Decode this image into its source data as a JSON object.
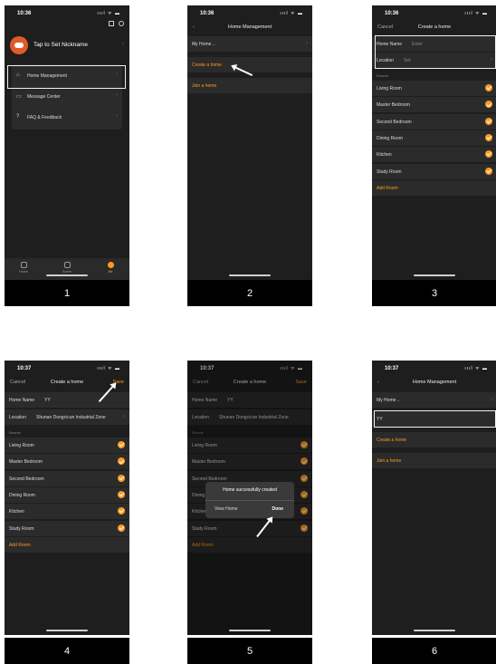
{
  "status": {
    "time_a": "10:36",
    "time_b": "10:37",
    "icons": "ıııl ᯤ ▬"
  },
  "step_labels": [
    "1",
    "2",
    "3",
    "4",
    "5",
    "6"
  ],
  "screen1": {
    "nickname": "Tap to Set Nickname",
    "menu": [
      "Home Management",
      "Message Center",
      "FAQ & Feedback"
    ],
    "tabs": [
      "Home",
      "Scene",
      "Me"
    ]
  },
  "screen2": {
    "title": "Home Management",
    "my_home": "My Home ..",
    "create": "Create a home",
    "join": "Join a home"
  },
  "screen3": {
    "cancel": "Cancel",
    "title": "Create a home",
    "home_name_label": "Home Name",
    "home_name_placeholder": "Enter",
    "location_label": "Location",
    "location_value": "Set",
    "rooms_header": "Rooms",
    "rooms": [
      "Living Room",
      "Master Bedroom",
      "Second Bedroom",
      "Dining Room",
      "Kitchen",
      "Study Room"
    ],
    "add_room": "Add Room"
  },
  "screen4": {
    "save": "Save",
    "home_name_value": "YY",
    "location_value": "Shunan Dongcicun Industrial Zone"
  },
  "screen5": {
    "dialog_title": "Home successfully created",
    "view_home": "View Home",
    "done": "Done"
  },
  "screen6": {
    "yy": "YY"
  },
  "colors": {
    "accent": "#ff9b21",
    "phone_bg": "#1e1e1e",
    "row_bg": "#2b2b2b"
  }
}
